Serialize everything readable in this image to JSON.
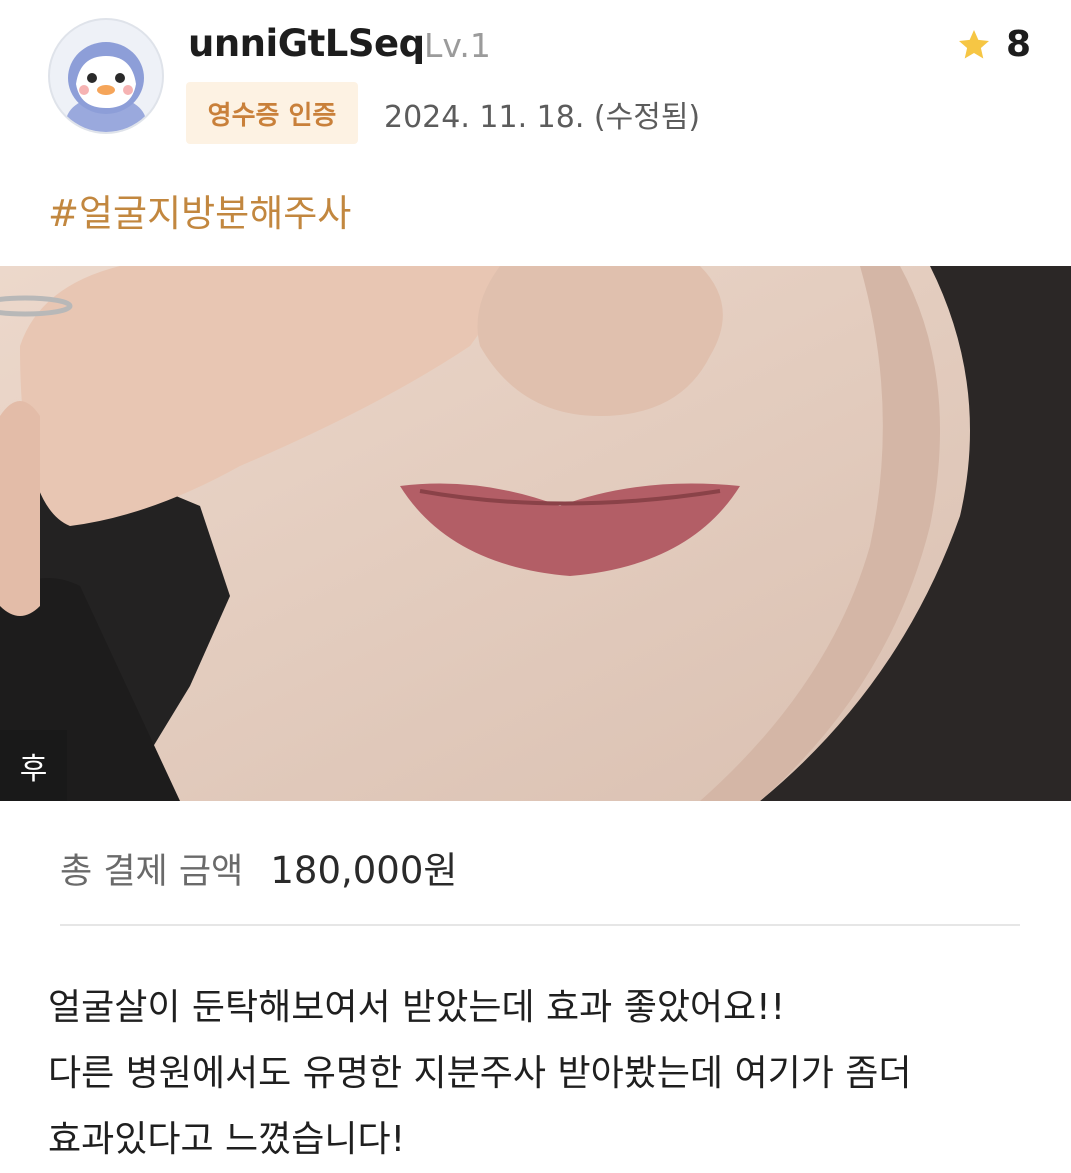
{
  "user": {
    "name": "unniGtLSeq",
    "level": "Lv.1",
    "avatar_icon": "penguin-avatar-icon"
  },
  "rating": {
    "icon": "star-icon",
    "value": "8",
    "star_color": "#f6c644"
  },
  "badge": {
    "label": "영수증 인증",
    "bg_color": "#fdf2e3",
    "text_color": "#c9803a"
  },
  "date": "2024. 11. 18. (수정됨)",
  "hashtag": {
    "text": "#얼굴지방분해주사",
    "color": "#c2873f"
  },
  "photo": {
    "tag": "후"
  },
  "payment": {
    "label": "총 결제 금액",
    "amount": "180,000원"
  },
  "review": {
    "lines": [
      "얼굴살이 둔탁해보여서 받았는데 효과 좋았어요!!",
      "다른 병원에서도 유명한 지분주사 받아봤는데 여기가 좀더",
      "효과있다고 느꼈습니다!"
    ]
  }
}
